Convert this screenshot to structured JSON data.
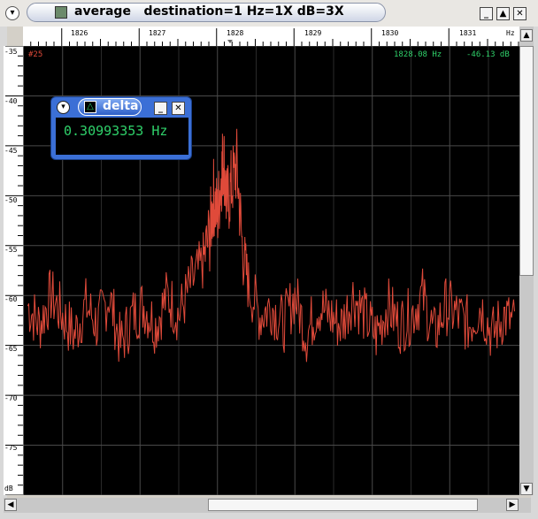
{
  "window": {
    "title": "average   destination=1 Hz=1X dB=3X"
  },
  "readout": {
    "trace_id": "#25",
    "frequency": "1828.08 Hz",
    "level": "-46.13 dB"
  },
  "delta_popup": {
    "title": "delta",
    "value": "0.30993353 Hz"
  },
  "x_axis": {
    "ticks": [
      "1826",
      "1827",
      "1828",
      "1829",
      "1830",
      "1831"
    ],
    "unit": "Hz"
  },
  "y_axis": {
    "ticks": [
      "-35",
      "-40",
      "-45",
      "-50",
      "-55",
      "-60",
      "-65",
      "-70",
      "-75"
    ],
    "unit": "dB"
  },
  "chart_data": {
    "type": "line",
    "xlim": [
      1825.5,
      1831.9
    ],
    "ylim": [
      -35,
      -80
    ],
    "trace_color": "#e04a3a",
    "grid": true,
    "series": [
      {
        "x": [
          1825.55,
          1825.7,
          1825.85,
          1826.0,
          1826.15,
          1826.3,
          1826.45,
          1826.6,
          1826.75,
          1826.9,
          1827.05,
          1827.2,
          1827.35,
          1827.5,
          1827.65,
          1827.8,
          1827.9,
          1827.95,
          1828.0,
          1828.05,
          1828.08,
          1828.12,
          1828.18,
          1828.25,
          1828.32,
          1828.4,
          1828.55,
          1828.7,
          1828.85,
          1829.0,
          1829.15,
          1829.3,
          1829.45,
          1829.6,
          1829.75,
          1829.9,
          1830.05,
          1830.2,
          1830.35,
          1830.5,
          1830.65,
          1830.8,
          1830.95,
          1831.1,
          1831.25,
          1831.4,
          1831.55,
          1831.7,
          1831.85
        ],
        "y": [
          -61,
          -63,
          -60,
          -62,
          -64,
          -61,
          -63,
          -60,
          -65,
          -62,
          -61,
          -63,
          -60,
          -62,
          -59,
          -57,
          -54,
          -50,
          -52,
          -48,
          -46,
          -51,
          -49,
          -47,
          -55,
          -59,
          -62,
          -61,
          -63,
          -60,
          -64,
          -61,
          -62,
          -63,
          -60,
          -62,
          -64,
          -61,
          -63,
          -62,
          -60,
          -64,
          -61,
          -62,
          -63,
          -61,
          -64,
          -62,
          -63
        ]
      }
    ]
  }
}
